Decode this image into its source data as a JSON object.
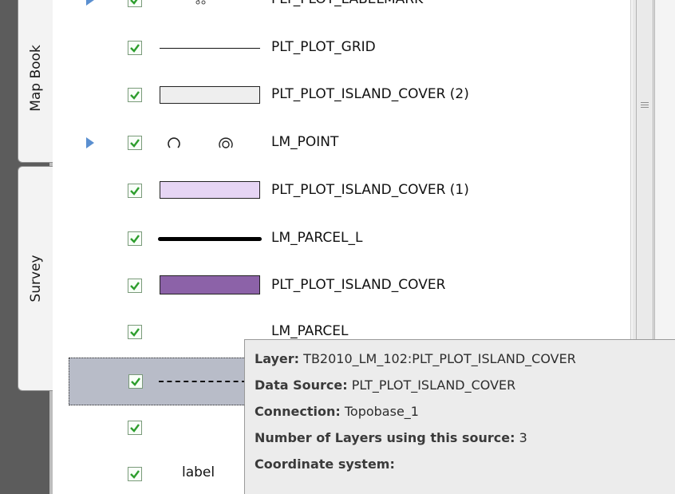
{
  "tabs": [
    {
      "label": "Map Book"
    },
    {
      "label": "Survey"
    }
  ],
  "layers": [
    {
      "label": "PLT_PLOT_LABELMARK",
      "checked": true,
      "symbol": "marker-icon",
      "expandable": true
    },
    {
      "label": "PLT_PLOT_GRID",
      "checked": true,
      "symbol": "thin-line"
    },
    {
      "label": "PLT_PLOT_ISLAND_COVER (2)",
      "checked": true,
      "symbol": "fill-light-gray"
    },
    {
      "label": "LM_POINT",
      "checked": true,
      "symbol": "point-circles",
      "expandable": true
    },
    {
      "label": "PLT_PLOT_ISLAND_COVER (1)",
      "checked": true,
      "symbol": "fill-lavender"
    },
    {
      "label": "LM_PARCEL_L",
      "checked": true,
      "symbol": "thick-line"
    },
    {
      "label": "PLT_PLOT_ISLAND_COVER",
      "checked": true,
      "symbol": "fill-purple"
    },
    {
      "label": "LM_PARCEL",
      "checked": true,
      "symbol": "none"
    },
    {
      "label": "",
      "checked": true,
      "symbol": "dashed-line",
      "selected": true
    },
    {
      "label": "",
      "checked": true,
      "symbol": "none"
    },
    {
      "label": "",
      "checked": true,
      "symbol": "label-text",
      "symbol_text": "label"
    }
  ],
  "colors": {
    "fill_light_gray": "#eeeeee",
    "fill_lavender": "#e6d5f4",
    "fill_purple": "#8c62a8",
    "check_green": "#2e9e2e",
    "expander_blue": "#5a8fd0"
  },
  "tooltip": {
    "lines": [
      {
        "key": "Layer:",
        "value": "TB2010_LM_102:PLT_PLOT_ISLAND_COVER"
      },
      {
        "key": "Data Source:",
        "value": "PLT_PLOT_ISLAND_COVER"
      },
      {
        "key": "Connection:",
        "value": "Topobase_1"
      },
      {
        "key": "Number of Layers using this source:",
        "value": "3"
      },
      {
        "key": "Coordinate system:",
        "value": ""
      }
    ]
  }
}
